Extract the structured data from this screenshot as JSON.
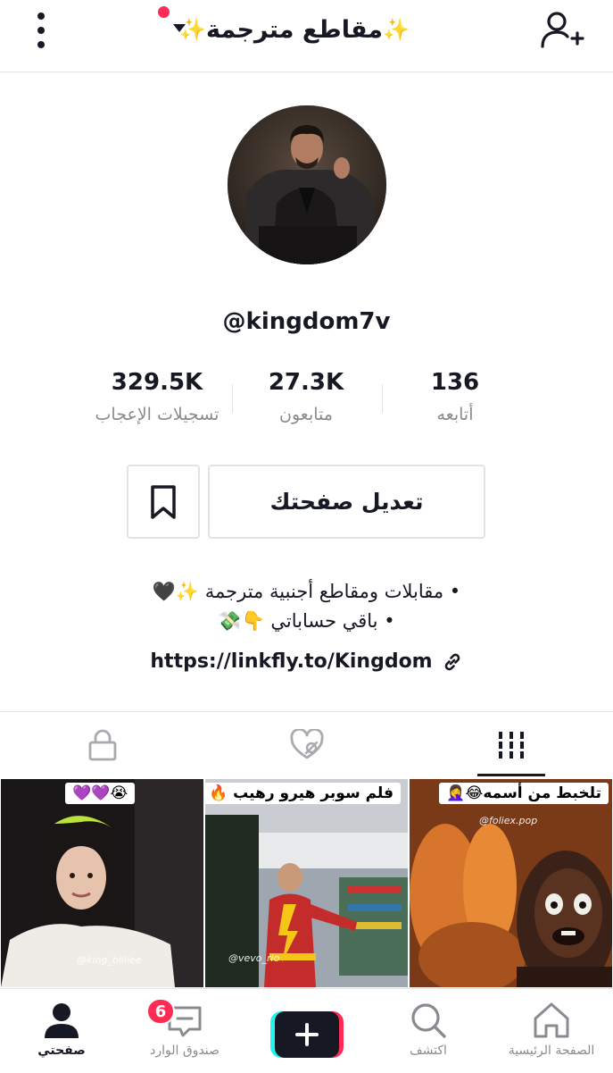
{
  "header": {
    "title": "مقاطع مترجمة",
    "sparkle_left": "✨",
    "sparkle_right": "✨",
    "has_notification_dot": true
  },
  "profile": {
    "username": "@kingdom7v",
    "stats": [
      {
        "value": "136",
        "label": "أتابعه"
      },
      {
        "value": "27.3K",
        "label": "متابعون"
      },
      {
        "value": "329.5K",
        "label": "تسجيلات الإعجاب"
      }
    ],
    "edit_button": "تعديل صفحتك",
    "bio_line1": "• مقابلات ومقاطع أجنبية مترجمة ✨🖤",
    "bio_line2": "• باقي حساباتي 👇💸",
    "link": "https://linkfly.to/Kingdom"
  },
  "tabs": [
    {
      "icon": "grid-icon",
      "active": true
    },
    {
      "icon": "liked-hidden-icon",
      "active": false
    },
    {
      "icon": "lock-icon",
      "active": false
    }
  ],
  "videos": [
    {
      "caption": "تلخبط من أسمه😂🤦‍♀️",
      "watermark": "@foliex.pop"
    },
    {
      "caption": "فلم سوبر هيرو رهيب 🔥",
      "watermark": "@vevo_rio"
    },
    {
      "caption": "😭💜💜",
      "watermark": "@king_billiee"
    }
  ],
  "bottom_nav": {
    "items": [
      {
        "label": "الصفحة الرئيسية",
        "icon": "home-icon"
      },
      {
        "label": "اكتشف",
        "icon": "search-icon"
      },
      {
        "label": "",
        "icon": "plus-icon"
      },
      {
        "label": "صندوق الوارد",
        "icon": "inbox-icon"
      },
      {
        "label": "صفحتي",
        "icon": "profile-icon"
      }
    ],
    "inbox_badge": "6",
    "accent_red": "#fe2c55",
    "accent_cyan": "#25f4ee"
  }
}
